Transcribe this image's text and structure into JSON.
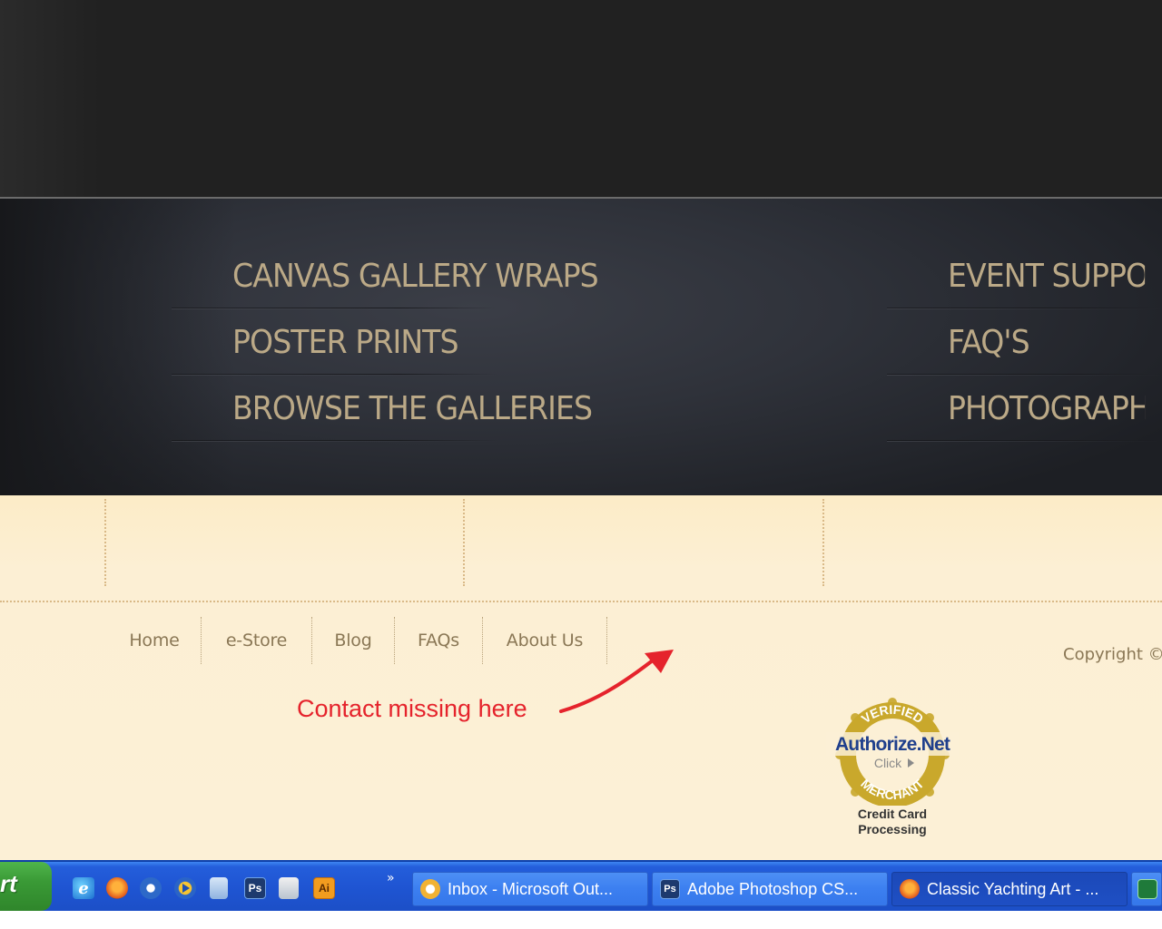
{
  "nav_left": [
    "CANVAS GALLERY WRAPS",
    "POSTER PRINTS",
    "BROWSE THE GALLERIES"
  ],
  "nav_right": [
    "EVENT SUPPOR",
    "FAQ'S",
    "PHOTOGRAPH"
  ],
  "footer_nav": [
    "Home",
    "e-Store",
    "Blog",
    "FAQs",
    "About Us"
  ],
  "copyright": "Copyright ©",
  "annotation": "Contact missing here",
  "seal": {
    "top_arc": "VERIFIED",
    "brand": "Authorize.Net",
    "click": "Click",
    "bottom_arc": "MERCHANT",
    "caption_line1": "Credit Card",
    "caption_line2": "Processing"
  },
  "taskbar": {
    "start_label": "rt",
    "overflow_chevron": "»",
    "quick_launch": [
      "ie-icon",
      "firefox-icon",
      "outlook-express-icon",
      "media-player-icon",
      "recycle-icon",
      "photoshop-icon",
      "calculator-icon",
      "illustrator-icon"
    ],
    "quick_launch_text": {
      "photoshop": "Ps",
      "illustrator": "Ai"
    },
    "tasks": [
      {
        "label": "Inbox - Microsoft Out...",
        "icon": "outlook-icon"
      },
      {
        "label": "Adobe Photoshop CS...",
        "icon": "photoshop-icon",
        "icon_text": "Ps"
      },
      {
        "label": "Classic Yachting Art - ...",
        "icon": "firefox-icon"
      }
    ]
  },
  "colors": {
    "nav_text": "#bba987",
    "footer_text": "#8a7755",
    "annotation": "#e5232c",
    "taskbar": "#245edb"
  }
}
